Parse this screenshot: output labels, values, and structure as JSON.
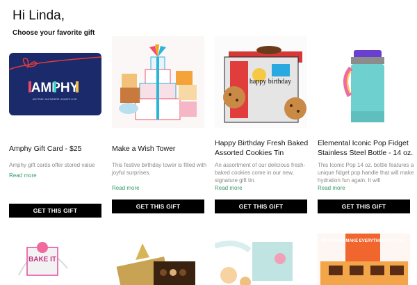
{
  "header": {
    "greeting": "Hi Linda,",
    "subtitle": "Choose your favorite gift"
  },
  "gifts": [
    {
      "title": "Amphy Gift Card - $25",
      "description": "Amphy gift cards offer stored value",
      "more": "Read more",
      "button": "GET THIS GIFT",
      "card_brand": "AMPHY",
      "card_tagline": "ANYTIME. ANYWHERE. ALWAYS LIVE.",
      "image": "gift-card"
    },
    {
      "title": "Make a Wish Tower",
      "description": "This festive birthday tower is filled with joyful surprises.",
      "more": "Read more",
      "button": "GET THIS GIFT",
      "image": "gift-tower"
    },
    {
      "title": "Happy Birthday Fresh Baked Assorted Cookies Tin",
      "description": "An assortment of our delicious fresh-baked cookies come in our new, signature gift tin.",
      "more": "Read more",
      "button": "GET THIS GIFT",
      "tin_text": "happy birthday",
      "image": "cookie-tin"
    },
    {
      "title": "Elemental Iconic Pop Fidget Stainless Steel Bottle - 14 oz.",
      "description": "This Iconic Pop 14 oz. bottle features a unique fidget pop handle that will make hydration fun again. It will",
      "more": "Read more",
      "button": "GET THIS GIFT",
      "image": "water-bottle"
    }
  ],
  "more_gifts": [
    {
      "image": "cake-box",
      "label": "BAKE IT"
    },
    {
      "image": "chocolate-box"
    },
    {
      "image": "cookie-box"
    },
    {
      "image": "brownie-box",
      "label": "BROWNIES MAKE EVERYTHING BETTER"
    }
  ],
  "colors": {
    "button": "#000000",
    "read_more": "#3a9a6a",
    "card_navy": "#1b2a6b"
  }
}
